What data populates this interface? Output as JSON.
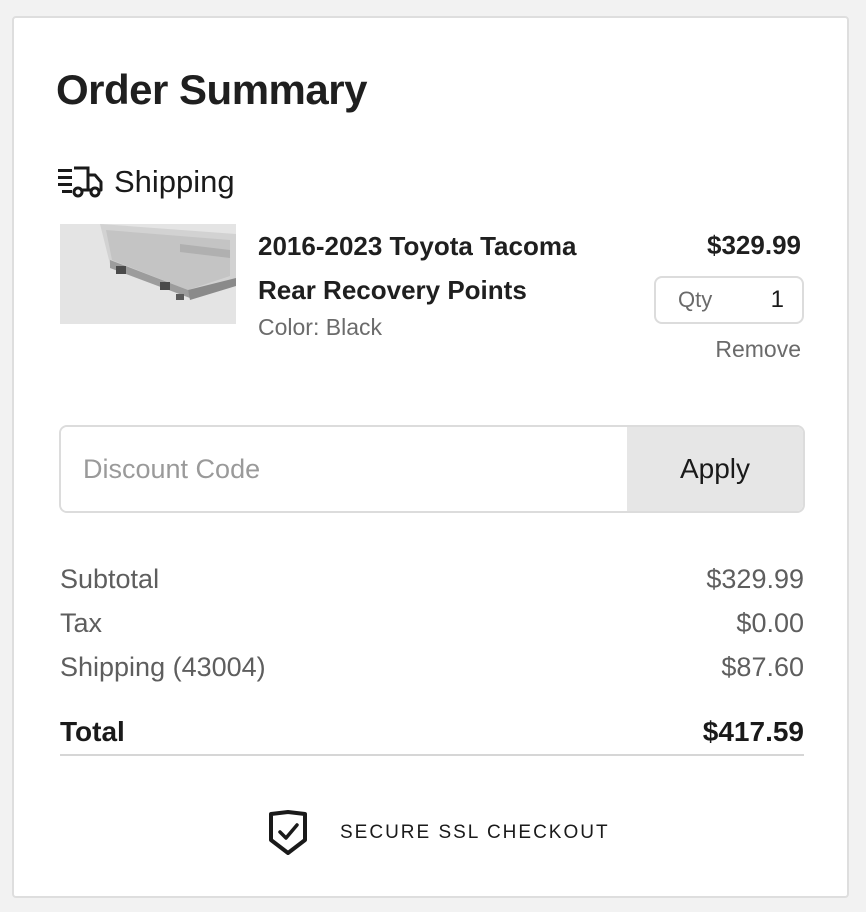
{
  "title": "Order Summary",
  "shipping": {
    "label": "Shipping",
    "icon": "truck-icon"
  },
  "item": {
    "image_alt": "product-photo",
    "name_line1": "2016-2023 Toyota Tacoma",
    "name_line2": "Rear Recovery Points",
    "color": "Color: Black",
    "price": "$329.99",
    "qty_label": "Qty",
    "qty_value": "1",
    "remove_label": "Remove"
  },
  "discount": {
    "placeholder": "Discount Code",
    "value": "",
    "apply_label": "Apply"
  },
  "summary": {
    "subtotal_label": "Subtotal",
    "subtotal_value": "$329.99",
    "tax_label": "Tax",
    "tax_value": "$0.00",
    "shipping_label": "Shipping (43004)",
    "shipping_value": "$87.60",
    "total_label": "Total",
    "total_value": "$417.59"
  },
  "secure": {
    "label": "SECURE SSL CHECKOUT",
    "icon": "shield-check-icon"
  },
  "colors": {
    "text": "#1a1a1a",
    "muted": "#6b6b6b",
    "border": "#dcdcdc",
    "button_bg": "#e6e6e6"
  }
}
